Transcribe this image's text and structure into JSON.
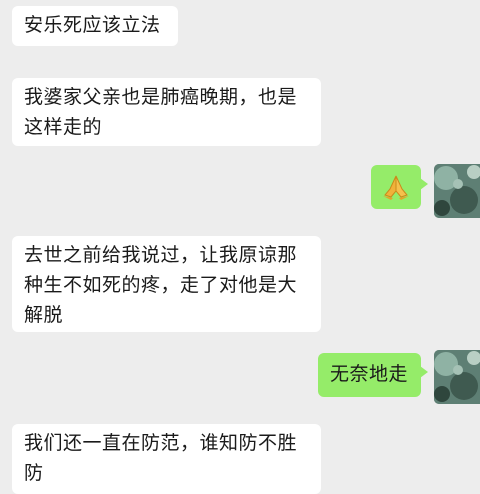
{
  "messages": [
    {
      "side": "left",
      "text": "安乐死应该立法"
    },
    {
      "side": "left",
      "text": "我婆家父亲也是肺癌晚期，也是这样走的"
    },
    {
      "side": "right",
      "icon": "praying-hands-emoji"
    },
    {
      "side": "left",
      "text": "去世之前给我说过，让我原谅那种生不如死的疼，走了对他是大解脱"
    },
    {
      "side": "right",
      "text": "无奈地走"
    },
    {
      "side": "left",
      "text": "我们还一直在防范，谁知防不胜防"
    }
  ]
}
